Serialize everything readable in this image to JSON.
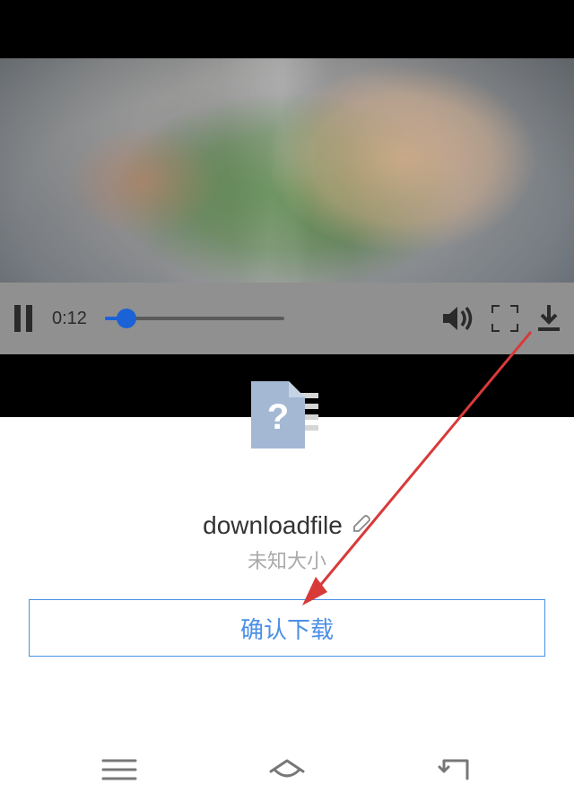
{
  "video": {
    "current_time": "0:12",
    "progress_percent": 12
  },
  "download": {
    "file_name": "downloadfile",
    "file_size_label": "未知大小",
    "confirm_label": "确认下载"
  },
  "icons": {
    "pause": "pause-icon",
    "volume": "volume-icon",
    "fullscreen": "fullscreen-icon",
    "download": "download-icon",
    "edit": "edit-icon",
    "menu": "menu-icon",
    "home": "home-icon",
    "back": "back-icon",
    "file": "file-question-icon"
  }
}
